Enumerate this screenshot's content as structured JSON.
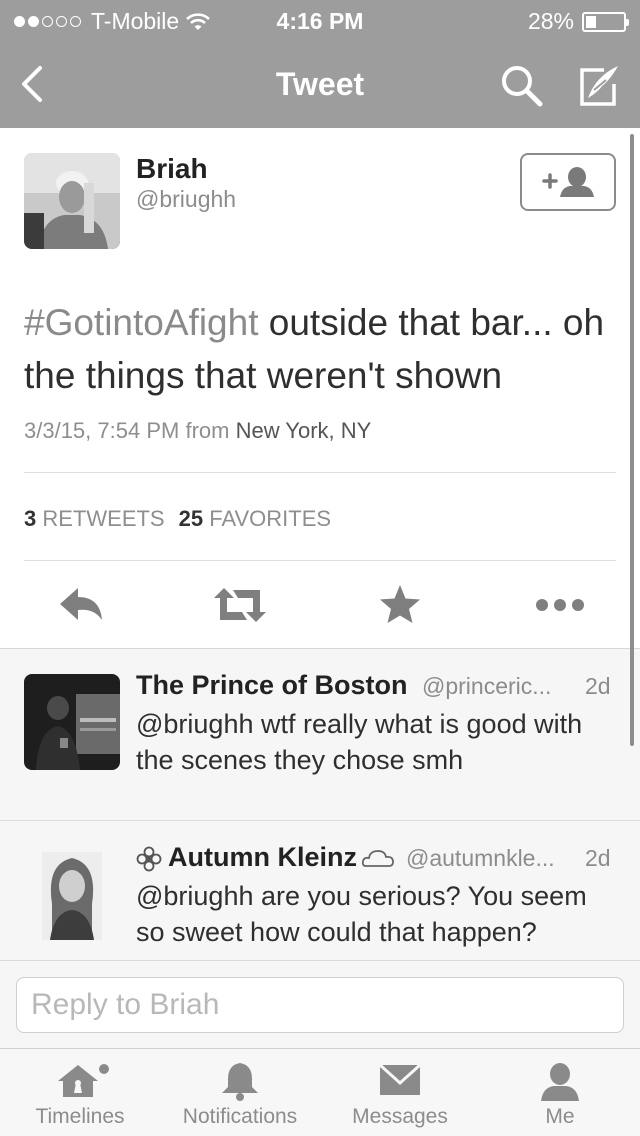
{
  "status_bar": {
    "carrier": "T-Mobile",
    "signal_bars_filled": 2,
    "signal_bars_total": 5,
    "time": "4:16 PM",
    "battery_percent_text": "28%",
    "battery_level": 0.28
  },
  "nav": {
    "title": "Tweet",
    "back_icon": "chevron-left-icon",
    "search_icon": "search-icon",
    "compose_icon": "compose-icon"
  },
  "tweet": {
    "author_name": "Briah",
    "author_handle": "@briughh",
    "hashtag": "#GotintoAfight",
    "text_rest": " outside that bar... oh the things that weren't shown",
    "date_time": "3/3/15, 7:54 PM",
    "from_label": "from",
    "location": "New York, NY",
    "retweets_count": "3",
    "retweets_label": "RETWEETS",
    "favorites_count": "25",
    "favorites_label": "FAVORITES"
  },
  "replies": [
    {
      "name": "The Prince of Boston",
      "handle": "@princeric...",
      "time": "2d",
      "text": "@briughh wtf really what is good with the scenes they chose smh"
    },
    {
      "name": "Autumn Kleinz",
      "handle": "@autumnkle...",
      "time": "2d",
      "text": "@briughh are you serious? You seem so sweet how could that happen?"
    }
  ],
  "reply_box": {
    "placeholder": "Reply to Briah"
  },
  "tabs": [
    {
      "label": "Timelines",
      "icon": "home-icon"
    },
    {
      "label": "Notifications",
      "icon": "bell-icon"
    },
    {
      "label": "Messages",
      "icon": "envelope-icon"
    },
    {
      "label": "Me",
      "icon": "person-icon"
    }
  ],
  "colors": {
    "nav_bar": "#9d9d9d",
    "muted_text": "#8c8c8c",
    "body_text": "#2f2f2f"
  }
}
